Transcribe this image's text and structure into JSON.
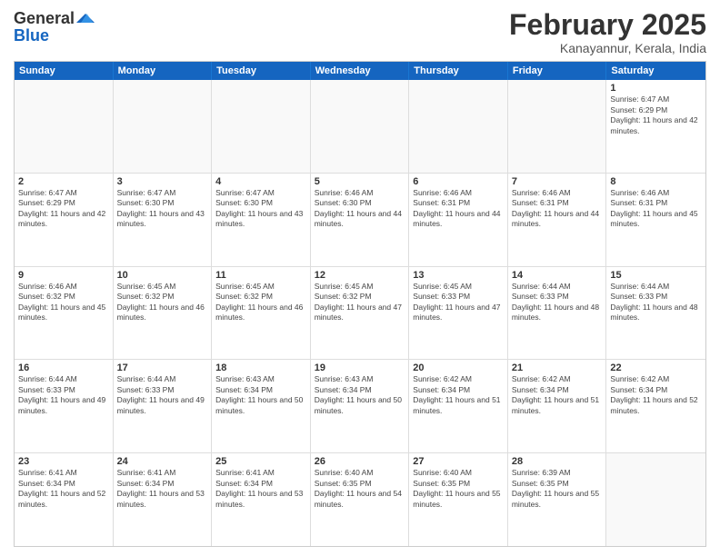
{
  "logo": {
    "text_general": "General",
    "text_blue": "Blue"
  },
  "header": {
    "month": "February 2025",
    "location": "Kanayannur, Kerala, India"
  },
  "weekdays": [
    "Sunday",
    "Monday",
    "Tuesday",
    "Wednesday",
    "Thursday",
    "Friday",
    "Saturday"
  ],
  "rows": [
    [
      {
        "day": "",
        "info": ""
      },
      {
        "day": "",
        "info": ""
      },
      {
        "day": "",
        "info": ""
      },
      {
        "day": "",
        "info": ""
      },
      {
        "day": "",
        "info": ""
      },
      {
        "day": "",
        "info": ""
      },
      {
        "day": "1",
        "info": "Sunrise: 6:47 AM\nSunset: 6:29 PM\nDaylight: 11 hours and 42 minutes."
      }
    ],
    [
      {
        "day": "2",
        "info": "Sunrise: 6:47 AM\nSunset: 6:29 PM\nDaylight: 11 hours and 42 minutes."
      },
      {
        "day": "3",
        "info": "Sunrise: 6:47 AM\nSunset: 6:30 PM\nDaylight: 11 hours and 43 minutes."
      },
      {
        "day": "4",
        "info": "Sunrise: 6:47 AM\nSunset: 6:30 PM\nDaylight: 11 hours and 43 minutes."
      },
      {
        "day": "5",
        "info": "Sunrise: 6:46 AM\nSunset: 6:30 PM\nDaylight: 11 hours and 44 minutes."
      },
      {
        "day": "6",
        "info": "Sunrise: 6:46 AM\nSunset: 6:31 PM\nDaylight: 11 hours and 44 minutes."
      },
      {
        "day": "7",
        "info": "Sunrise: 6:46 AM\nSunset: 6:31 PM\nDaylight: 11 hours and 44 minutes."
      },
      {
        "day": "8",
        "info": "Sunrise: 6:46 AM\nSunset: 6:31 PM\nDaylight: 11 hours and 45 minutes."
      }
    ],
    [
      {
        "day": "9",
        "info": "Sunrise: 6:46 AM\nSunset: 6:32 PM\nDaylight: 11 hours and 45 minutes."
      },
      {
        "day": "10",
        "info": "Sunrise: 6:45 AM\nSunset: 6:32 PM\nDaylight: 11 hours and 46 minutes."
      },
      {
        "day": "11",
        "info": "Sunrise: 6:45 AM\nSunset: 6:32 PM\nDaylight: 11 hours and 46 minutes."
      },
      {
        "day": "12",
        "info": "Sunrise: 6:45 AM\nSunset: 6:32 PM\nDaylight: 11 hours and 47 minutes."
      },
      {
        "day": "13",
        "info": "Sunrise: 6:45 AM\nSunset: 6:33 PM\nDaylight: 11 hours and 47 minutes."
      },
      {
        "day": "14",
        "info": "Sunrise: 6:44 AM\nSunset: 6:33 PM\nDaylight: 11 hours and 48 minutes."
      },
      {
        "day": "15",
        "info": "Sunrise: 6:44 AM\nSunset: 6:33 PM\nDaylight: 11 hours and 48 minutes."
      }
    ],
    [
      {
        "day": "16",
        "info": "Sunrise: 6:44 AM\nSunset: 6:33 PM\nDaylight: 11 hours and 49 minutes."
      },
      {
        "day": "17",
        "info": "Sunrise: 6:44 AM\nSunset: 6:33 PM\nDaylight: 11 hours and 49 minutes."
      },
      {
        "day": "18",
        "info": "Sunrise: 6:43 AM\nSunset: 6:34 PM\nDaylight: 11 hours and 50 minutes."
      },
      {
        "day": "19",
        "info": "Sunrise: 6:43 AM\nSunset: 6:34 PM\nDaylight: 11 hours and 50 minutes."
      },
      {
        "day": "20",
        "info": "Sunrise: 6:42 AM\nSunset: 6:34 PM\nDaylight: 11 hours and 51 minutes."
      },
      {
        "day": "21",
        "info": "Sunrise: 6:42 AM\nSunset: 6:34 PM\nDaylight: 11 hours and 51 minutes."
      },
      {
        "day": "22",
        "info": "Sunrise: 6:42 AM\nSunset: 6:34 PM\nDaylight: 11 hours and 52 minutes."
      }
    ],
    [
      {
        "day": "23",
        "info": "Sunrise: 6:41 AM\nSunset: 6:34 PM\nDaylight: 11 hours and 52 minutes."
      },
      {
        "day": "24",
        "info": "Sunrise: 6:41 AM\nSunset: 6:34 PM\nDaylight: 11 hours and 53 minutes."
      },
      {
        "day": "25",
        "info": "Sunrise: 6:41 AM\nSunset: 6:34 PM\nDaylight: 11 hours and 53 minutes."
      },
      {
        "day": "26",
        "info": "Sunrise: 6:40 AM\nSunset: 6:35 PM\nDaylight: 11 hours and 54 minutes."
      },
      {
        "day": "27",
        "info": "Sunrise: 6:40 AM\nSunset: 6:35 PM\nDaylight: 11 hours and 55 minutes."
      },
      {
        "day": "28",
        "info": "Sunrise: 6:39 AM\nSunset: 6:35 PM\nDaylight: 11 hours and 55 minutes."
      },
      {
        "day": "",
        "info": ""
      }
    ]
  ]
}
